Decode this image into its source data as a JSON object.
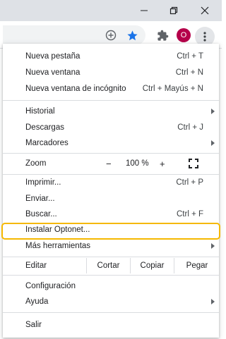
{
  "menu": {
    "new_tab": {
      "label": "Nueva pestaña",
      "shortcut": "Ctrl + T"
    },
    "new_window": {
      "label": "Nueva ventana",
      "shortcut": "Ctrl + N"
    },
    "incognito": {
      "label": "Nueva ventana de incógnito",
      "shortcut": "Ctrl + Mayús + N"
    },
    "history": {
      "label": "Historial"
    },
    "downloads": {
      "label": "Descargas",
      "shortcut": "Ctrl + J"
    },
    "bookmarks": {
      "label": "Marcadores"
    },
    "zoom": {
      "label": "Zoom",
      "minus": "−",
      "value": "100 %",
      "plus": "+"
    },
    "print": {
      "label": "Imprimir...",
      "shortcut": "Ctrl + P"
    },
    "cast": {
      "label": "Enviar..."
    },
    "find": {
      "label": "Buscar...",
      "shortcut": "Ctrl + F"
    },
    "install": {
      "label": "Instalar Optonet..."
    },
    "more_tools": {
      "label": "Más herramientas"
    },
    "edit": {
      "label": "Editar",
      "cut": "Cortar",
      "copy": "Copiar",
      "paste": "Pegar"
    },
    "settings": {
      "label": "Configuración"
    },
    "help": {
      "label": "Ayuda"
    },
    "exit": {
      "label": "Salir"
    }
  },
  "toolbar": {
    "avatar_letter": "O",
    "icons": [
      "add-circle-icon",
      "star-icon",
      "extensions-icon",
      "kebab-menu-icon"
    ]
  },
  "window": {
    "icons": [
      "minimize-icon",
      "restore-icon",
      "close-icon"
    ]
  },
  "colors": {
    "highlight": "#f5b800",
    "star": "#1a73e8",
    "avatar": "#b5004a",
    "titlebar": "#dee1e6"
  }
}
